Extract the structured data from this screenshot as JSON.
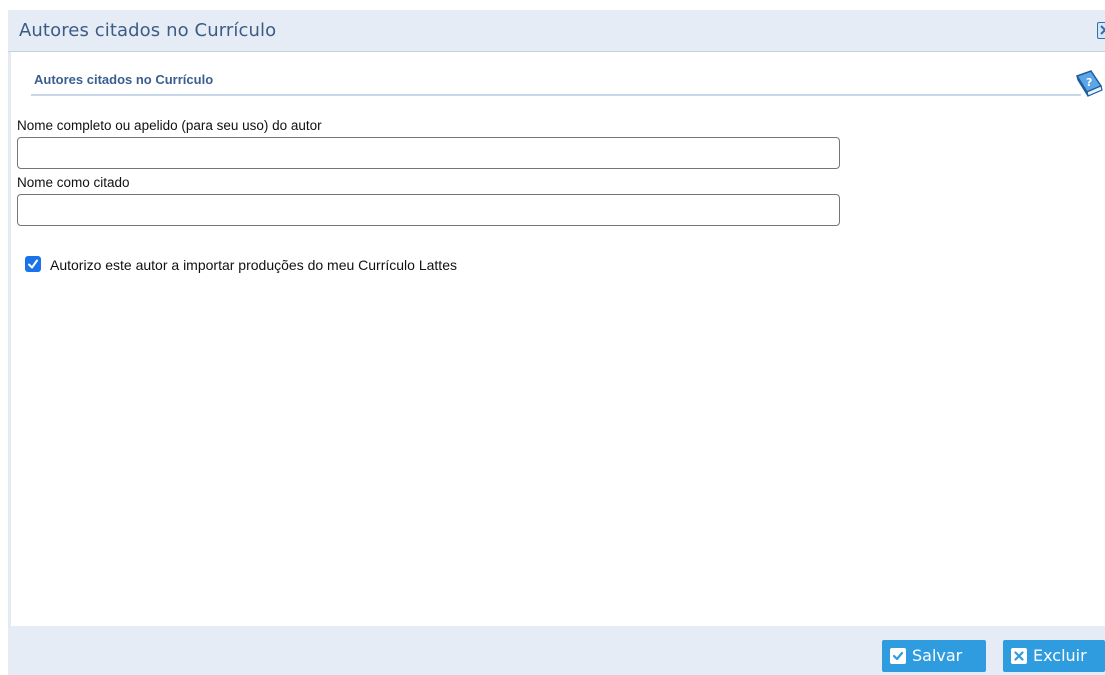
{
  "dialog": {
    "title": "Autores citados no Currículo",
    "close_icon": "close-icon"
  },
  "section": {
    "heading": "Autores citados no Currículo",
    "help_icon": "help-book-icon"
  },
  "form": {
    "full_name": {
      "label": "Nome completo ou apelido (para seu uso) do autor",
      "value": ""
    },
    "cited_name": {
      "label": "Nome como citado",
      "value": ""
    },
    "authorize": {
      "label": "Autorizo este autor a importar produções do meu Currículo Lattes",
      "checked": true
    }
  },
  "footer": {
    "save_label": "Salvar",
    "delete_label": "Excluir"
  },
  "colors": {
    "accent": "#2f9ce0",
    "title_text": "#3b5c86",
    "checkbox": "#1a73e8"
  }
}
